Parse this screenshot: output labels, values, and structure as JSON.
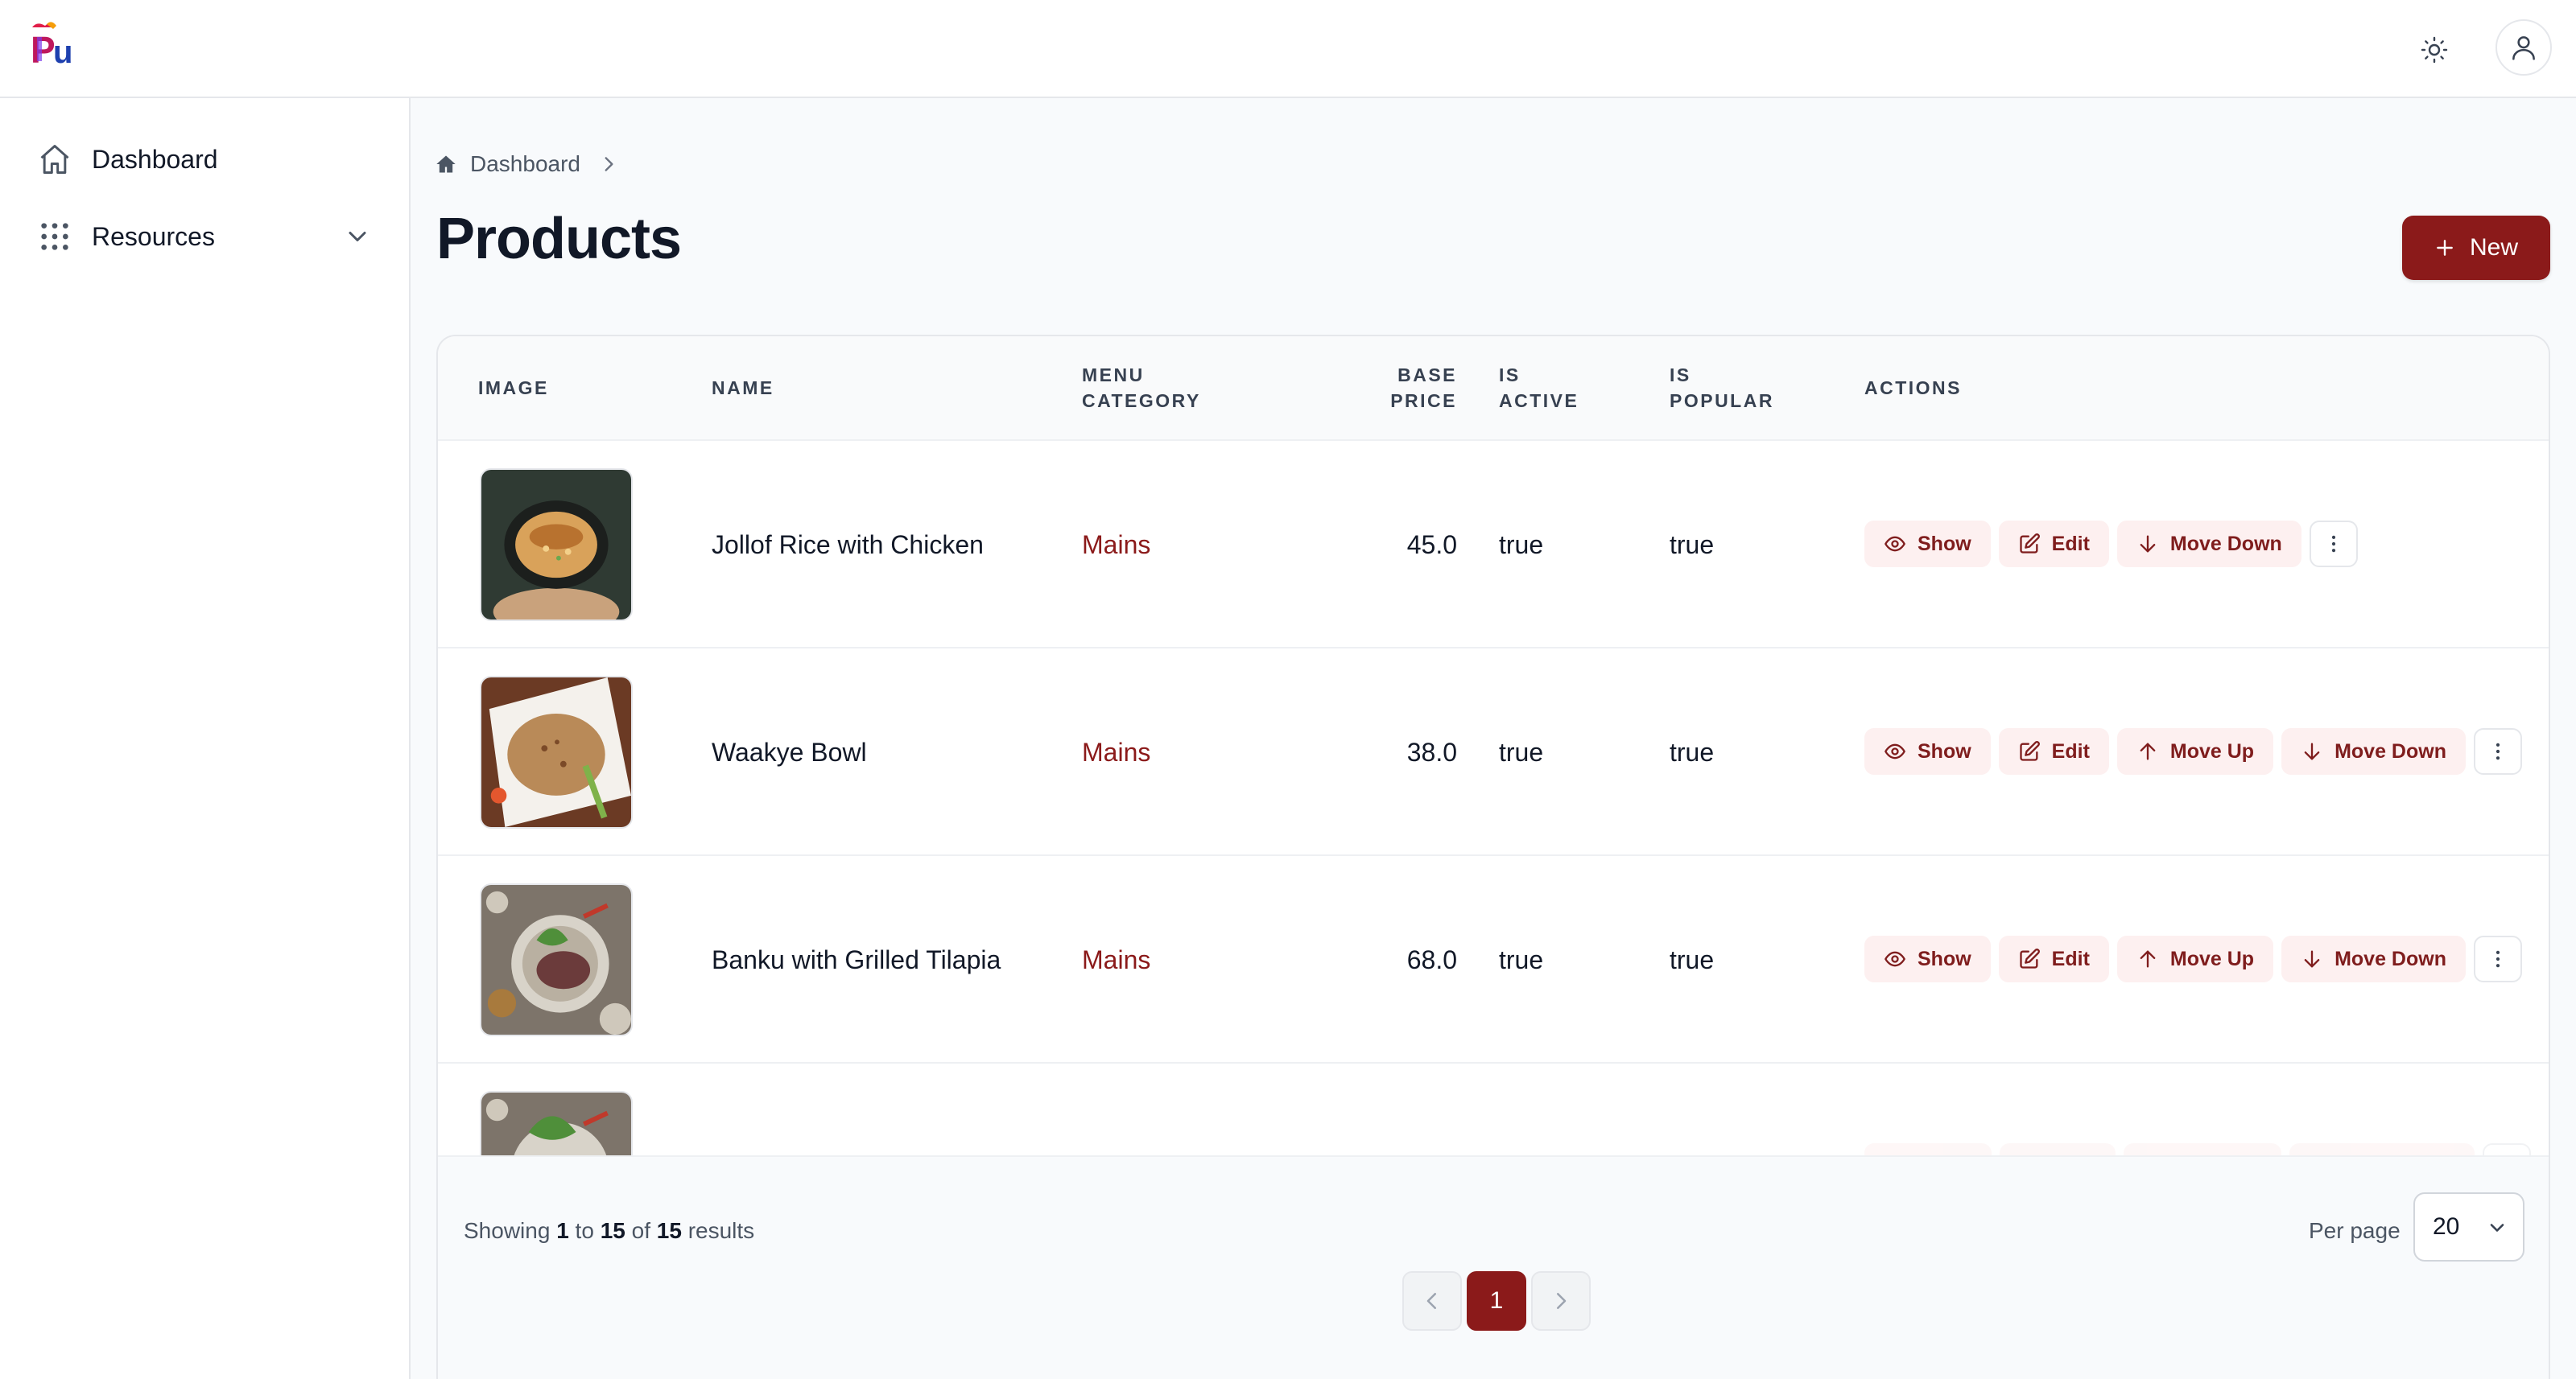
{
  "app": {
    "logo_text": "Pu"
  },
  "topbar": {
    "theme_icon": "sun-icon",
    "user_icon": "user-icon"
  },
  "sidebar": {
    "items": [
      {
        "label": "Dashboard",
        "icon": "home-icon"
      },
      {
        "label": "Resources",
        "icon": "grid-dots-icon",
        "expandable": true
      }
    ]
  },
  "breadcrumb": {
    "items": [
      "Dashboard"
    ]
  },
  "page": {
    "title": "Products",
    "new_button": "New"
  },
  "table": {
    "columns": {
      "image": "IMAGE",
      "name": "NAME",
      "menu_category_1": "MENU",
      "menu_category_2": "CATEGORY",
      "base_price_1": "BASE",
      "base_price_2": "PRICE",
      "is_active_1": "IS",
      "is_active_2": "ACTIVE",
      "is_popular_1": "IS",
      "is_popular_2": "POPULAR",
      "actions": "ACTIONS"
    },
    "rows": [
      {
        "name": "Jollof Rice with Chicken",
        "category": "Mains",
        "base_price": "45.0",
        "is_active": "true",
        "is_popular": "true"
      },
      {
        "name": "Waakye Bowl",
        "category": "Mains",
        "base_price": "38.0",
        "is_active": "true",
        "is_popular": "true"
      },
      {
        "name": "Banku with Grilled Tilapia",
        "category": "Mains",
        "base_price": "68.0",
        "is_active": "true",
        "is_popular": "true"
      }
    ],
    "action_labels": {
      "show": "Show",
      "edit": "Edit",
      "move_up": "Move Up",
      "move_down": "Move Down"
    }
  },
  "footer": {
    "showing_prefix": "Showing",
    "from": "1",
    "to_word": "to",
    "to": "15",
    "of_word": "of",
    "total": "15",
    "results_word": "results",
    "per_page_label": "Per page",
    "per_page_value": "20",
    "current_page": "1"
  },
  "colors": {
    "primary": "#8b1a1a",
    "action_bg": "#fdf0f0",
    "action_text": "#7f1d1d"
  }
}
